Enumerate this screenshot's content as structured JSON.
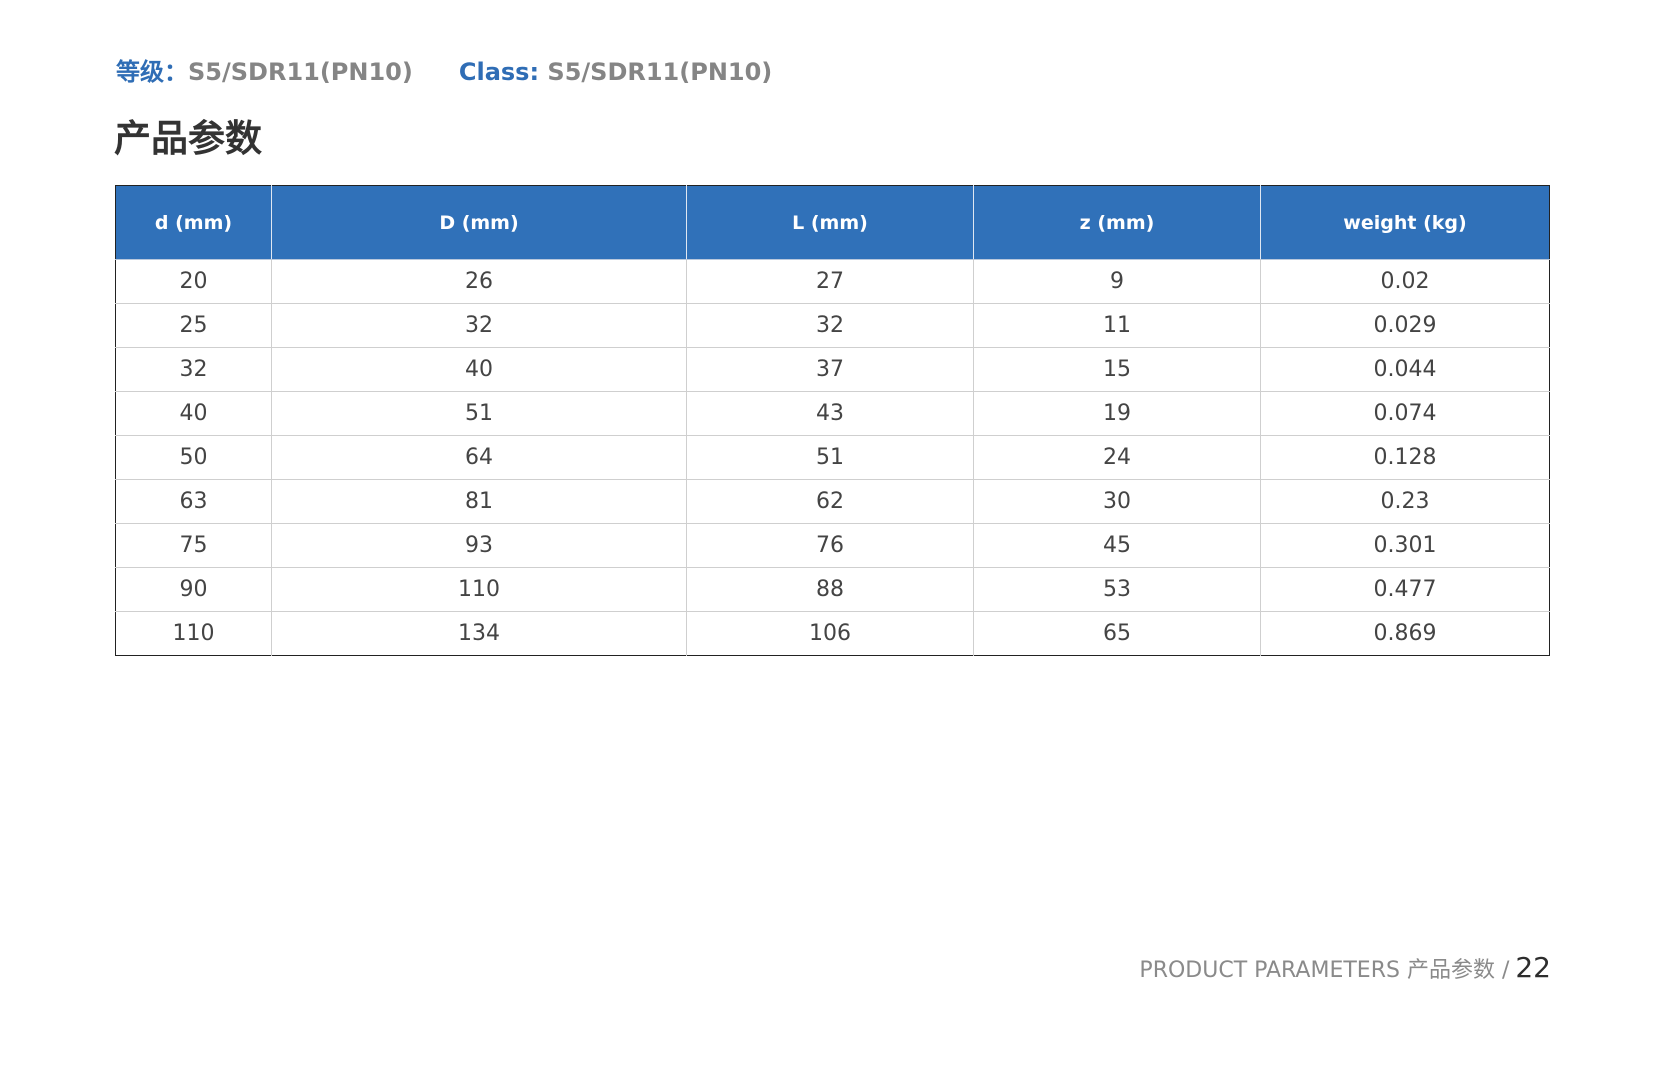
{
  "grade": {
    "cn_label": "等级：",
    "cn_value": "S5/SDR11(PN10)",
    "en_label": "Class: ",
    "en_value": "S5/SDR11(PN10)"
  },
  "title": "产品参数",
  "table": {
    "headers": [
      "d (mm)",
      "D (mm)",
      "L (mm)",
      "z (mm)",
      "weight (kg)"
    ],
    "rows": [
      [
        "20",
        "26",
        "27",
        "9",
        "0.02"
      ],
      [
        "25",
        "32",
        "32",
        "11",
        "0.029"
      ],
      [
        "32",
        "40",
        "37",
        "15",
        "0.044"
      ],
      [
        "40",
        "51",
        "43",
        "19",
        "0.074"
      ],
      [
        "50",
        "64",
        "51",
        "24",
        "0.128"
      ],
      [
        "63",
        "81",
        "62",
        "30",
        "0.23"
      ],
      [
        "75",
        "93",
        "76",
        "45",
        "0.301"
      ],
      [
        "90",
        "110",
        "88",
        "53",
        "0.477"
      ],
      [
        "110",
        "134",
        "106",
        "65",
        "0.869"
      ]
    ]
  },
  "footer": {
    "text": "PRODUCT PARAMETERS  产品参数 /",
    "page_number": "22"
  },
  "colors": {
    "accent_blue": "#3071b9",
    "label_blue": "#2f6db5",
    "value_gray": "#858585"
  }
}
